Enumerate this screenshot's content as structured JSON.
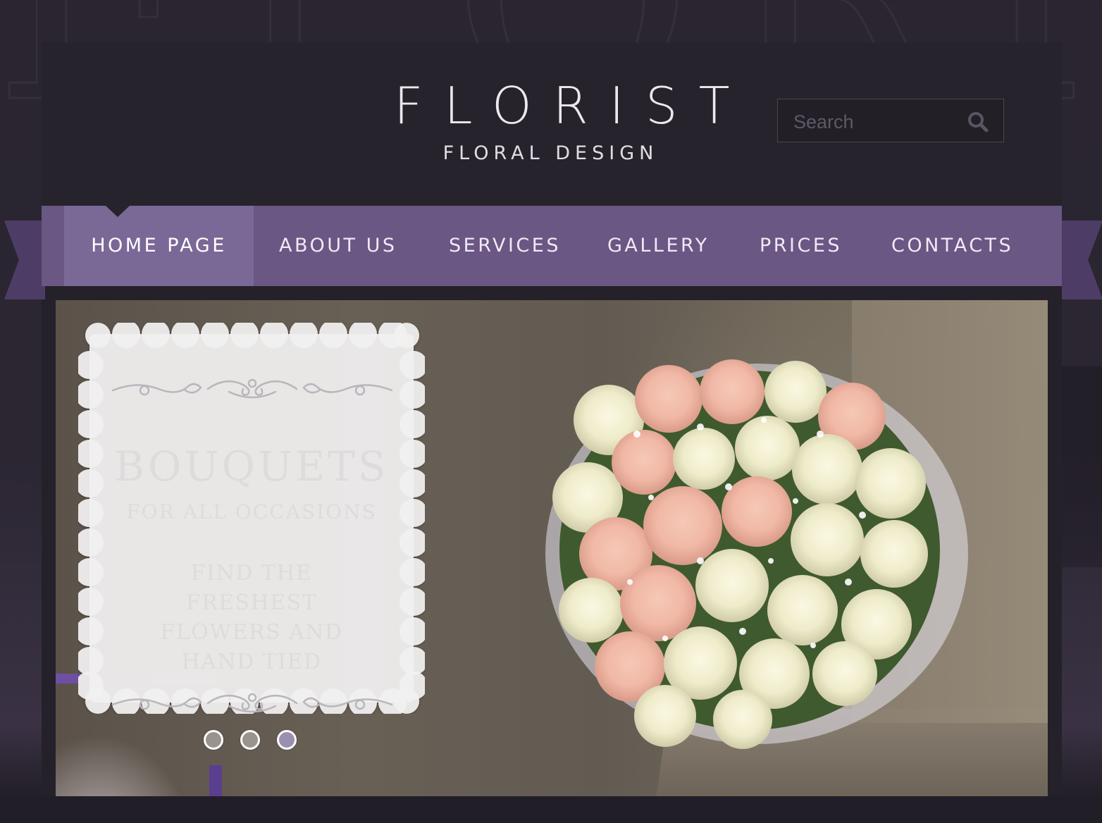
{
  "logo": {
    "title": "FLORIST",
    "subtitle": "FLORAL DESIGN"
  },
  "search": {
    "placeholder": "Search",
    "icon": "search-icon"
  },
  "nav": {
    "items": [
      {
        "label": "HOME PAGE",
        "active": true
      },
      {
        "label": "ABOUT US",
        "active": false
      },
      {
        "label": "SERVICES",
        "active": false
      },
      {
        "label": "GALLERY",
        "active": false
      },
      {
        "label": "PRICES",
        "active": false
      },
      {
        "label": "CONTACTS",
        "active": false
      }
    ]
  },
  "slider": {
    "title": "BOUQUETS",
    "subtitle": "FOR ALL OCCASIONS",
    "body": "FIND THE FRESHEST FLOWERS AND HAND TIED",
    "slide_count": 3,
    "active_slide": 3,
    "image": "rose-bouquet"
  },
  "colors": {
    "background": "#2a2530",
    "panel": "#27232c",
    "nav": "#6a5783",
    "nav_active": "#7a6896",
    "ribbon_tail": "#4d3d66",
    "card": "#f2f1f1"
  }
}
